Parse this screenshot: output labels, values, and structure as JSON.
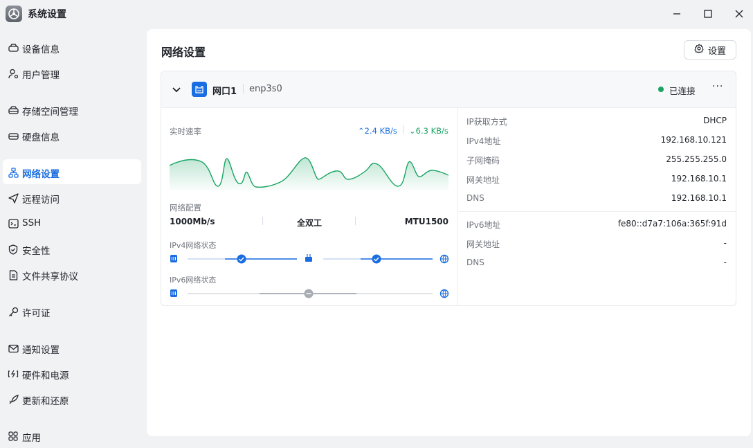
{
  "window": {
    "title": "系统设置"
  },
  "sidebar": {
    "items": [
      {
        "label": "设备信息",
        "icon": "drive-icon"
      },
      {
        "label": "用户管理",
        "icon": "user-gear-icon"
      },
      {
        "label": "存储空间管理",
        "icon": "storage-icon"
      },
      {
        "label": "硬盘信息",
        "icon": "disk-icon"
      },
      {
        "label": "网络设置",
        "icon": "network-icon",
        "active": true
      },
      {
        "label": "远程访问",
        "icon": "send-icon"
      },
      {
        "label": "SSH",
        "icon": "terminal-icon"
      },
      {
        "label": "安全性",
        "icon": "shield-icon"
      },
      {
        "label": "文件共享协议",
        "icon": "document-icon"
      },
      {
        "label": "许可证",
        "icon": "key-icon"
      },
      {
        "label": "通知设置",
        "icon": "mail-icon"
      },
      {
        "label": "硬件和电源",
        "icon": "battery-icon"
      },
      {
        "label": "更新和还原",
        "icon": "rocket-icon"
      },
      {
        "label": "应用",
        "icon": "apps-icon"
      }
    ]
  },
  "main": {
    "title": "网络设置",
    "settings_label": "设置",
    "port": {
      "name": "网口1",
      "iface": "enp3s0",
      "status": "已连接",
      "status_color": "#19a463",
      "speed_label": "实时速率",
      "up": "2.4 KB/s",
      "down": "6.3 KB/s",
      "config_label": "网络配置",
      "config": [
        "1000Mb/s",
        "全双工",
        "MTU1500"
      ],
      "ipv4_status_label": "IPv4网络状态",
      "ipv6_status_label": "IPv6网络状态",
      "ipv4": [
        {
          "k": "IP获取方式",
          "v": "DHCP"
        },
        {
          "k": "IPv4地址",
          "v": "192.168.10.121"
        },
        {
          "k": "子网掩码",
          "v": "255.255.255.0"
        },
        {
          "k": "网关地址",
          "v": "192.168.10.1"
        },
        {
          "k": "DNS",
          "v": "192.168.10.1"
        }
      ],
      "ipv6": [
        {
          "k": "IPv6地址",
          "v": "fe80::d7a7:106a:365f:91d"
        },
        {
          "k": "网关地址",
          "v": "-"
        },
        {
          "k": "DNS",
          "v": "-"
        }
      ]
    }
  },
  "colors": {
    "accent": "#1a6de0",
    "up": "#1a6de0",
    "down": "#19a463"
  }
}
